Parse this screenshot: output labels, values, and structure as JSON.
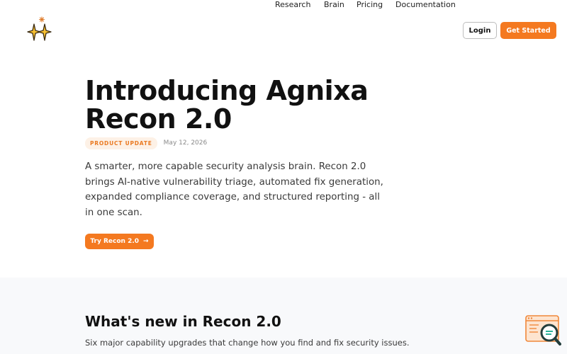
{
  "nav": {
    "links": [
      "Research",
      "Brain",
      "Pricing",
      "Documentation"
    ],
    "login_label": "Login",
    "get_started_label": "Get Started"
  },
  "hero": {
    "title": "Introducing Agnixa Recon 2.0",
    "badge": "PRODUCT UPDATE",
    "date": "May 12, 2026",
    "description": "A smarter, more capable security analysis brain. Recon 2.0 brings AI-native vulnerability triage, automated fix generation, expanded compliance coverage, and structured reporting - all in one scan.",
    "cta_label": "Try Recon 2.0",
    "cta_arrow": "→"
  },
  "whats_new": {
    "title": "What's new in Recon 2.0",
    "subtitle": "Six major capability upgrades that change how you find and fix security issues."
  },
  "colors": {
    "accent": "#f47920",
    "badge_bg": "#fdf1e6",
    "section_bg": "#f8f9fb"
  },
  "icons": {
    "logo": "sparkle-logo-icon",
    "widget": "code-search-widget-icon"
  }
}
